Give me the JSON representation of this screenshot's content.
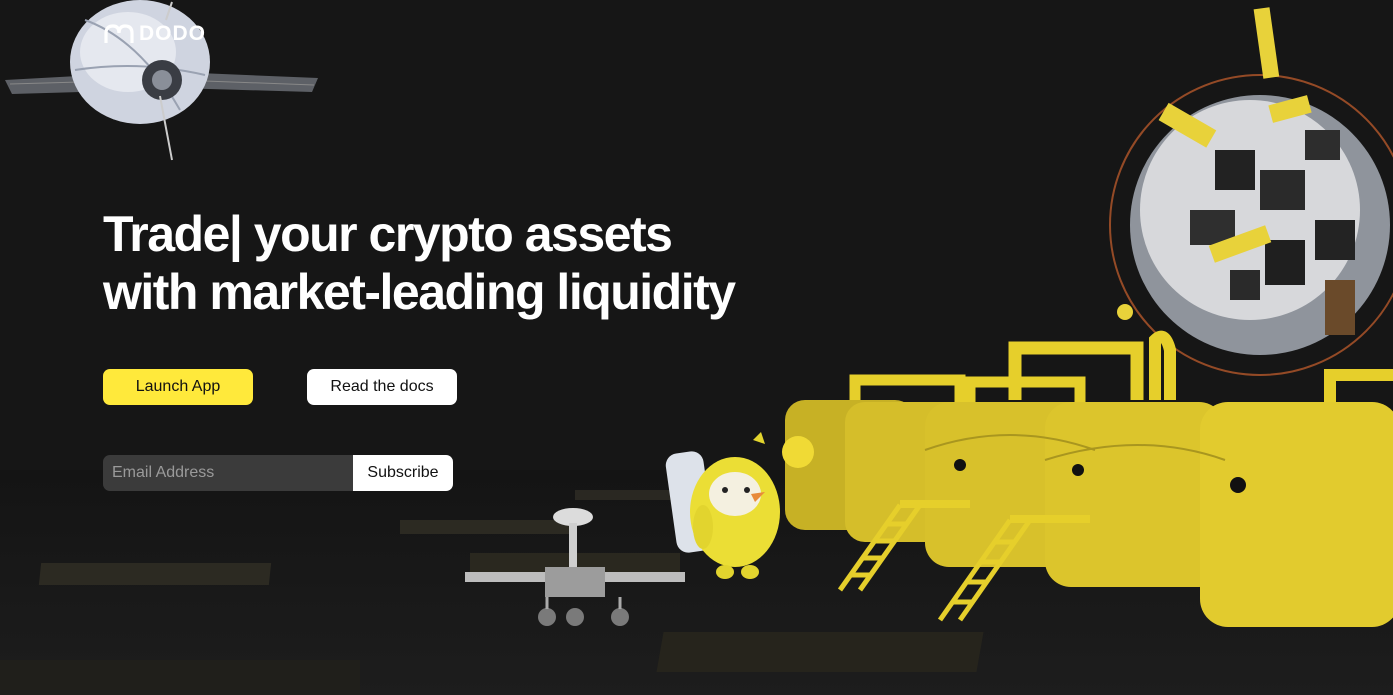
{
  "brand": {
    "name": "DODO"
  },
  "hero": {
    "title_line1": "Trade| your crypto assets",
    "title_line2": "with market-leading liquidity"
  },
  "actions": {
    "launch_label": "Launch App",
    "docs_label": "Read the docs"
  },
  "newsletter": {
    "placeholder": "Email Address",
    "value": "",
    "button_label": "Subscribe"
  },
  "colors": {
    "background": "#161616",
    "accent_yellow": "#ffe93b",
    "text_white": "#ffffff",
    "input_background": "#3b3b3b"
  },
  "illustration": {
    "items": [
      "satellite",
      "mascot-bird",
      "moon-rover",
      "yellow-storage-tanks",
      "space-station-sphere",
      "solar-panels"
    ]
  }
}
